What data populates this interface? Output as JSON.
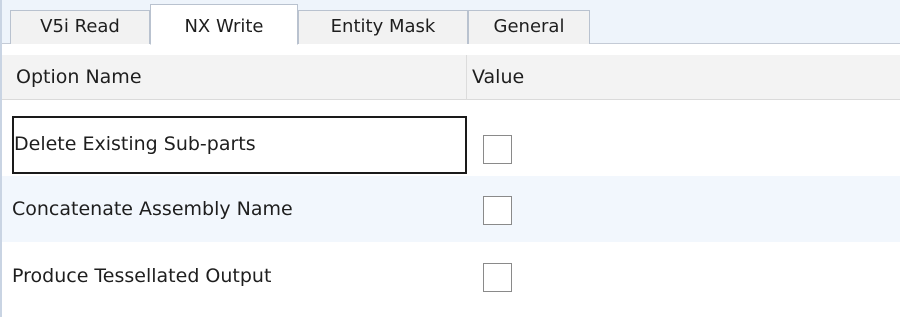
{
  "tabs": [
    {
      "label": "V5i Read",
      "selected": false
    },
    {
      "label": "NX Write",
      "selected": true
    },
    {
      "label": "Entity Mask",
      "selected": false
    },
    {
      "label": "General",
      "selected": false
    }
  ],
  "grid": {
    "columns": [
      "Option Name",
      "Value"
    ],
    "rows": [
      {
        "name": "Delete Existing Sub-parts",
        "checked": false,
        "focused": true
      },
      {
        "name": "Concatenate Assembly Name",
        "checked": false,
        "focused": false
      },
      {
        "name": "Produce Tessellated Output",
        "checked": false,
        "focused": false
      }
    ]
  },
  "colors": {
    "tab_strip_bg": "#eef4fb",
    "alt_row_bg": "#f2f7fd",
    "header_bg": "#f3f3f3"
  }
}
